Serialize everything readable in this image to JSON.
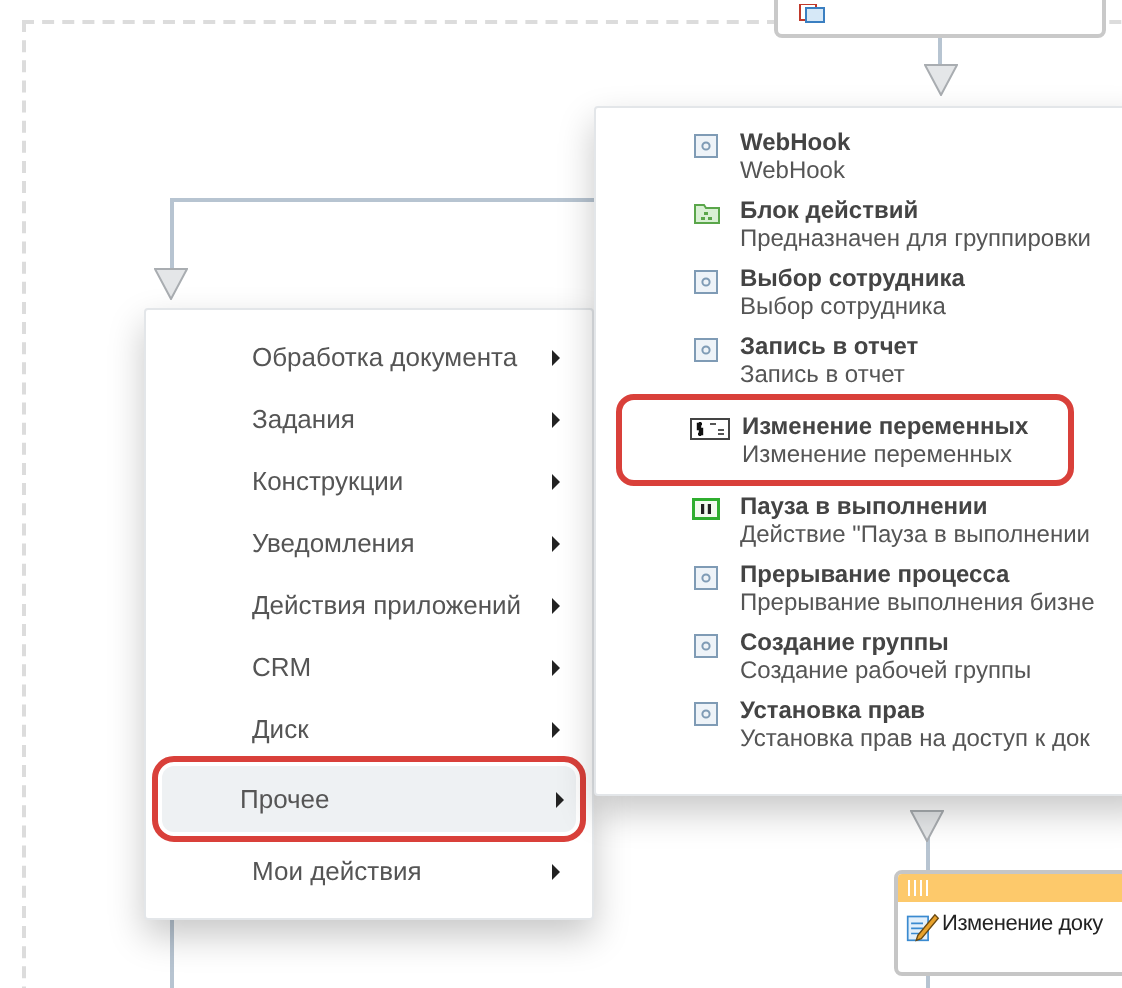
{
  "categories": [
    {
      "label": "Обработка документа",
      "selected": false
    },
    {
      "label": "Задания",
      "selected": false
    },
    {
      "label": "Конструкции",
      "selected": false
    },
    {
      "label": "Уведомления",
      "selected": false
    },
    {
      "label": "Действия приложений",
      "selected": false
    },
    {
      "label": "CRM",
      "selected": false
    },
    {
      "label": "Диск",
      "selected": false
    },
    {
      "label": "Прочее",
      "selected": true
    },
    {
      "label": "Мои действия",
      "selected": false
    }
  ],
  "activities": [
    {
      "kind": "generic",
      "title": "WebHook",
      "description": "WebHook",
      "highlighted": false
    },
    {
      "kind": "block",
      "title": "Блок действий",
      "description": "Предназначен для группировки",
      "highlighted": false
    },
    {
      "kind": "generic",
      "title": "Выбор сотрудника",
      "description": "Выбор сотрудника",
      "highlighted": false
    },
    {
      "kind": "generic",
      "title": "Запись в отчет",
      "description": "Запись в отчет",
      "highlighted": false
    },
    {
      "kind": "variables",
      "title": "Изменение переменных",
      "description": "Изменение переменных",
      "highlighted": true
    },
    {
      "kind": "pause",
      "title": "Пауза в выполнении",
      "description": "Действие \"Пауза в выполнении",
      "highlighted": false
    },
    {
      "kind": "generic",
      "title": "Прерывание процесса",
      "description": "Прерывание выполнения бизне",
      "highlighted": false
    },
    {
      "kind": "generic",
      "title": "Создание группы",
      "description": "Создание рабочей группы",
      "highlighted": false
    },
    {
      "kind": "generic",
      "title": "Установка прав",
      "description": "Установка прав на доступ к док",
      "highlighted": false
    }
  ],
  "bottom_block": {
    "title": "Изменение доку"
  }
}
